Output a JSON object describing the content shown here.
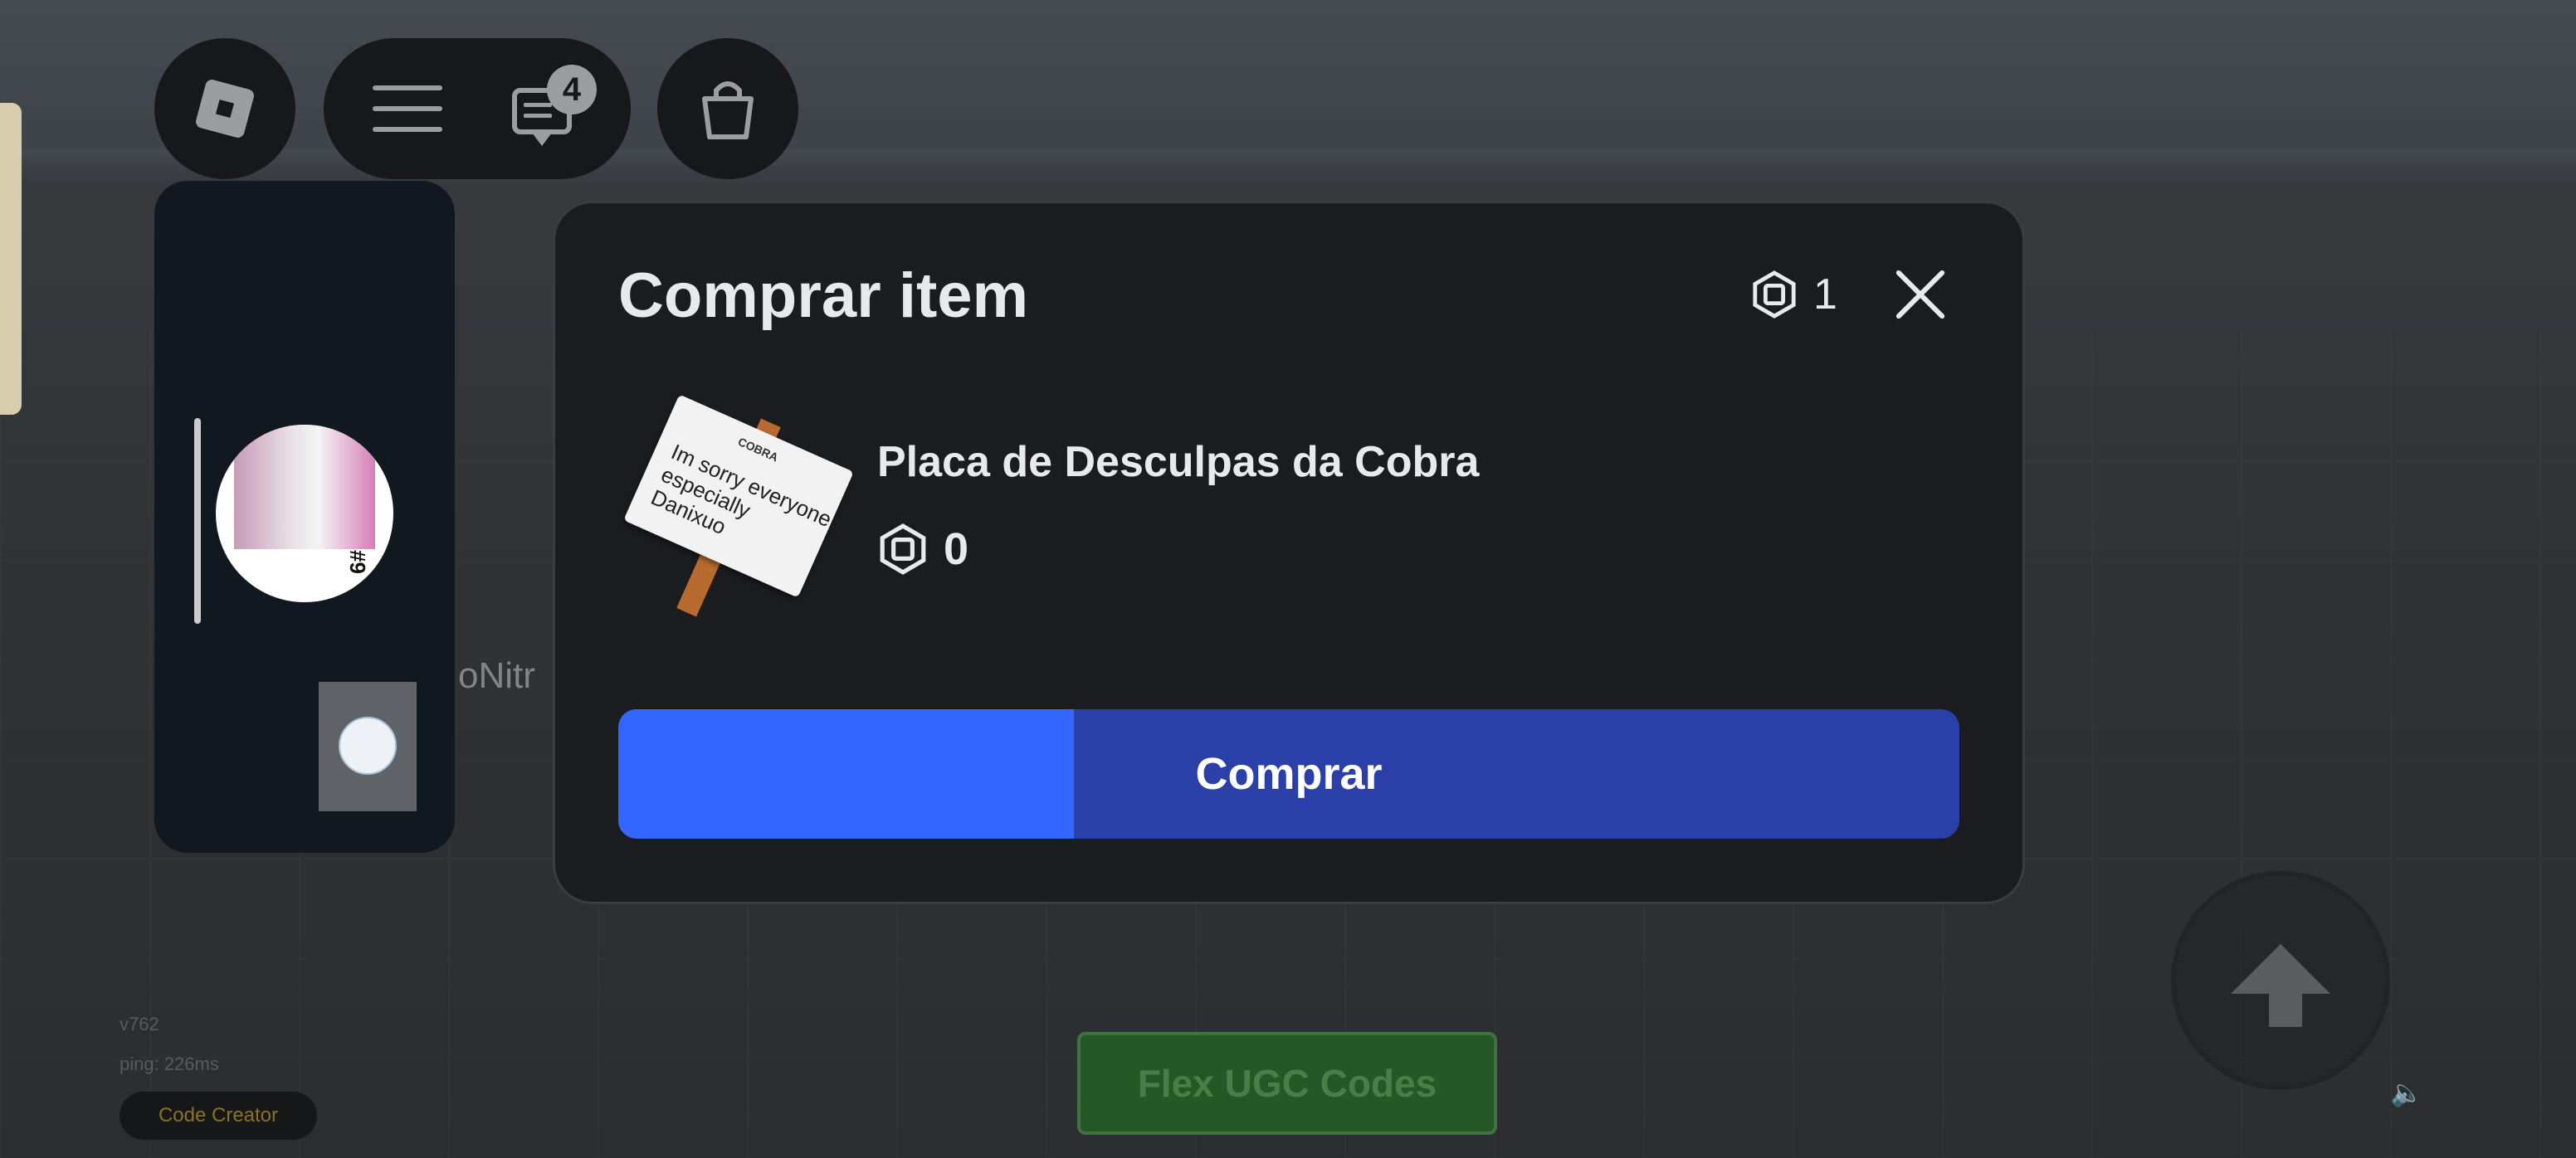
{
  "topbar": {
    "roblox_icon": "roblox-logo-icon",
    "menu_icon": "hamburger-menu-icon",
    "chat_icon": "chat-icon",
    "chat_badge": "4",
    "shop_icon": "shopping-bag-icon"
  },
  "sidebar": {
    "avatar_tag": "#9"
  },
  "background": {
    "player_name": "oNitr",
    "version": "v762",
    "ping": "ping: 226ms",
    "code_creator": "Code Creator",
    "flex_button": "Flex UGC Codes"
  },
  "modal": {
    "title": "Comprar item",
    "balance": "1",
    "item": {
      "name": "Placa de Desculpas da Cobra",
      "price": "0",
      "sign_brand": "COBRA",
      "sign_text_1": "Im sorry everyone",
      "sign_text_2": "especially Danixuo"
    },
    "buy_button": "Comprar",
    "buy_progress": 0.34
  },
  "colors": {
    "accent": "#3366ff",
    "button_base": "#2b3fa8",
    "modal_bg": "#1b1c1f"
  }
}
